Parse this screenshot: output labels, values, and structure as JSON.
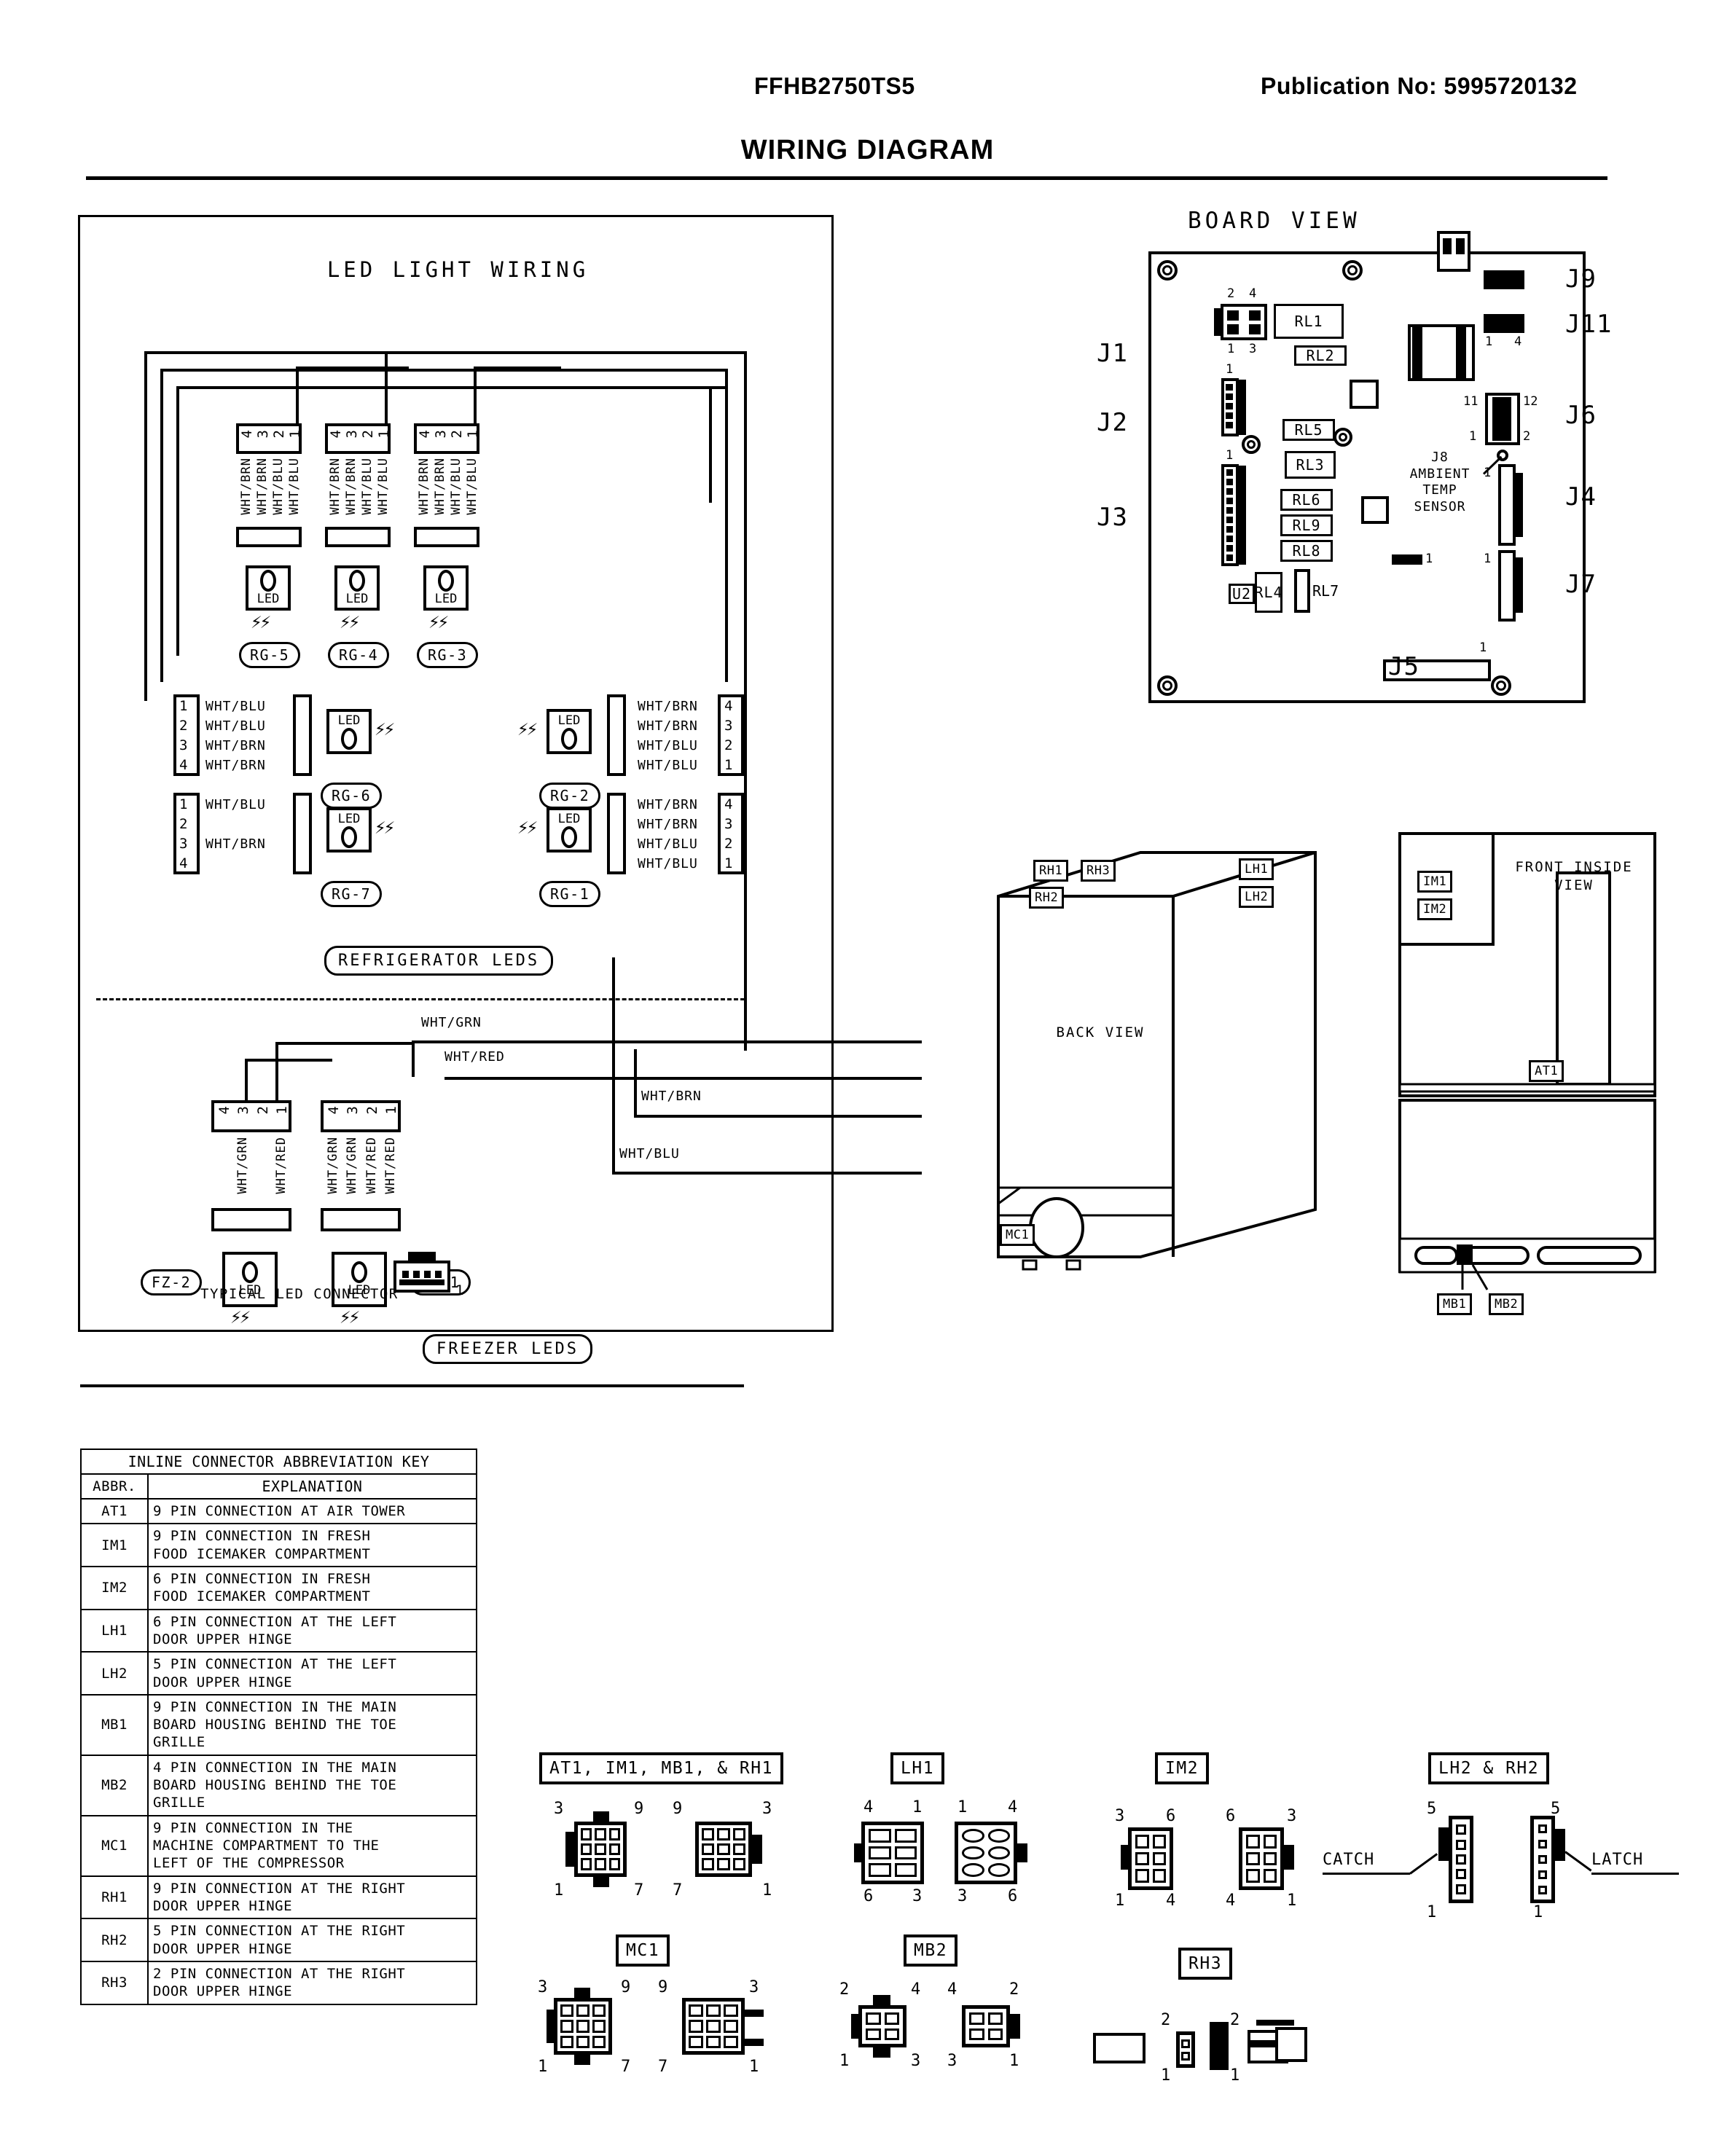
{
  "header": {
    "model": "FFHB2750TS5",
    "publication": "Publication No:  5995720132",
    "title": "WIRING DIAGRAM"
  },
  "led_panel": {
    "title": "LED LIGHT WIRING",
    "refrigerator_group_label": "REFRIGERATOR LEDS",
    "freezer_group_label": "FREEZER LEDS",
    "typical_connector_label": "TYPICAL LED CONNECTOR",
    "typical_connector_pin": "1",
    "led_text": "LED",
    "top_connectors": [
      {
        "tag": "RG-5",
        "pins": [
          "4",
          "3",
          "2",
          "1"
        ],
        "wires": [
          "WHT/BRN",
          "WHT/BRN",
          "WHT/BLU",
          "WHT/BLU"
        ]
      },
      {
        "tag": "RG-4",
        "pins": [
          "4",
          "3",
          "2",
          "1"
        ],
        "wires": [
          "WHT/BRN",
          "WHT/BRN",
          "WHT/BLU",
          "WHT/BLU"
        ]
      },
      {
        "tag": "RG-3",
        "pins": [
          "4",
          "3",
          "2",
          "1"
        ],
        "wires": [
          "WHT/BRN",
          "WHT/BRN",
          "WHT/BLU",
          "WHT/BLU"
        ]
      }
    ],
    "mid_connectors": [
      {
        "tag": "RG-6",
        "side": "left",
        "pins": [
          "1",
          "2",
          "3",
          "4"
        ],
        "wires": [
          "WHT/BLU",
          "WHT/BLU",
          "WHT/BRN",
          "WHT/BRN"
        ]
      },
      {
        "tag": "RG-2",
        "side": "right",
        "pins": [
          "4",
          "3",
          "2",
          "1"
        ],
        "wires": [
          "WHT/BRN",
          "WHT/BRN",
          "WHT/BLU",
          "WHT/BLU"
        ]
      },
      {
        "tag": "RG-7",
        "side": "left",
        "pins": [
          "1",
          "2",
          "3",
          "4"
        ],
        "wires": [
          "WHT/BLU",
          "",
          "WHT/BRN",
          ""
        ]
      },
      {
        "tag": "RG-1",
        "side": "right",
        "pins": [
          "4",
          "3",
          "2",
          "1"
        ],
        "wires": [
          "WHT/BRN",
          "WHT/BRN",
          "WHT/BLU",
          "WHT/BLU"
        ]
      }
    ],
    "freezer_connectors": [
      {
        "tag": "FZ-2",
        "pins": [
          "4",
          "3",
          "2",
          "1"
        ],
        "wires": [
          "",
          "WHT/GRN",
          "",
          "WHT/RED"
        ]
      },
      {
        "tag": "FZ-1",
        "pins": [
          "4",
          "3",
          "2",
          "1"
        ],
        "wires": [
          "WHT/GRN",
          "WHT/GRN",
          "WHT/RED",
          "WHT/RED"
        ]
      }
    ],
    "bus_labels": {
      "wht_grn": "WHT/GRN",
      "wht_red": "WHT/RED",
      "wht_brn": "WHT/BRN",
      "wht_blu": "WHT/BLU"
    }
  },
  "board": {
    "title": "BOARD VIEW",
    "connectors": [
      "J1",
      "J2",
      "J3",
      "J4",
      "J5",
      "J6",
      "J7",
      "J9",
      "J11"
    ],
    "j1_pins": {
      "top_left": "2",
      "top_right": "4",
      "bottom_left": "1",
      "bottom_right": "3"
    },
    "j2_pin1": "1",
    "j3_pin1": "1",
    "j4_pin1": "1",
    "j5_pin1": "1",
    "j6_pins": {
      "top_left": "11",
      "top_right": "12",
      "bottom_left": "1",
      "bottom_right": "2"
    },
    "j7_pin1": "1",
    "j11_pins": {
      "left": "1",
      "right": "4"
    },
    "j10_pin1": "1",
    "relays": [
      "RL1",
      "RL2",
      "RL5",
      "RL3",
      "RL6",
      "RL9",
      "RL8",
      "RL4",
      "RL7"
    ],
    "ic": "U2",
    "sensor_label": "J8\nAMBIENT\nTEMP\nSENSOR"
  },
  "cabinet": {
    "back_view_label": "BACK VIEW",
    "front_view_label": "FRONT INSIDE\nVIEW",
    "back_tags": [
      "RH1",
      "RH3",
      "RH2",
      "LH1",
      "LH2",
      "MC1"
    ],
    "front_tags": [
      "IM1",
      "IM2",
      "AT1",
      "MB1",
      "MB2"
    ]
  },
  "key_table": {
    "title": "INLINE CONNECTOR ABBREVIATION KEY",
    "columns": [
      "ABBR.",
      "EXPLANATION"
    ],
    "rows": [
      {
        "abbr": "AT1",
        "explanation": "9 PIN CONNECTION AT AIR TOWER"
      },
      {
        "abbr": "IM1",
        "explanation": "9 PIN CONNECTION IN FRESH\nFOOD ICEMAKER COMPARTMENT"
      },
      {
        "abbr": "IM2",
        "explanation": "6 PIN CONNECTION IN FRESH\nFOOD ICEMAKER COMPARTMENT"
      },
      {
        "abbr": "LH1",
        "explanation": "6 PIN CONNECTION AT THE LEFT\nDOOR UPPER HINGE"
      },
      {
        "abbr": "LH2",
        "explanation": "5 PIN CONNECTION AT THE LEFT\nDOOR UPPER HINGE"
      },
      {
        "abbr": "MB1",
        "explanation": "9 PIN CONNECTION IN THE MAIN\nBOARD HOUSING BEHIND THE TOE\nGRILLE"
      },
      {
        "abbr": "MB2",
        "explanation": "4 PIN CONNECTION IN THE MAIN\nBOARD HOUSING BEHIND THE TOE\nGRILLE"
      },
      {
        "abbr": "MC1",
        "explanation": "9 PIN CONNECTION IN THE\nMACHINE COMPARTMENT TO THE\nLEFT OF THE COMPRESSOR"
      },
      {
        "abbr": "RH1",
        "explanation": "9 PIN CONNECTION AT THE RIGHT\nDOOR UPPER HINGE"
      },
      {
        "abbr": "RH2",
        "explanation": "5 PIN CONNECTION AT THE RIGHT\nDOOR UPPER HINGE"
      },
      {
        "abbr": "RH3",
        "explanation": "2 PIN CONNECTION AT THE RIGHT\nDOOR UPPER HINGE"
      }
    ]
  },
  "connector_figures": [
    {
      "title": "AT1, IM1, MB1, & RH1",
      "corners_left": [
        "3",
        "9",
        "1",
        "7"
      ],
      "corners_right": [
        "9",
        "3",
        "7",
        "1"
      ]
    },
    {
      "title": "LH1",
      "corners_left": [
        "4",
        "1",
        "6",
        "3"
      ],
      "corners_right": [
        "1",
        "4",
        "3",
        "6"
      ]
    },
    {
      "title": "IM2",
      "corners_left": [
        "3",
        "6",
        "1",
        "4"
      ],
      "corners_right": [
        "6",
        "3",
        "4",
        "1"
      ]
    },
    {
      "title": "LH2 & RH2",
      "corners_left": [
        "5",
        "1"
      ],
      "corners_right": [
        "5",
        "1"
      ],
      "catch": "CATCH",
      "latch": "LATCH"
    },
    {
      "title": "MC1",
      "corners_left": [
        "3",
        "9",
        "1",
        "7"
      ],
      "corners_right": [
        "9",
        "3",
        "7",
        "1"
      ]
    },
    {
      "title": "MB2",
      "corners_left": [
        "2",
        "4",
        "1",
        "3"
      ],
      "corners_right": [
        "4",
        "2",
        "3",
        "1"
      ]
    },
    {
      "title": "RH3",
      "corners_left": [
        "2",
        "1"
      ],
      "corners_right": [
        "2",
        "1"
      ]
    }
  ]
}
